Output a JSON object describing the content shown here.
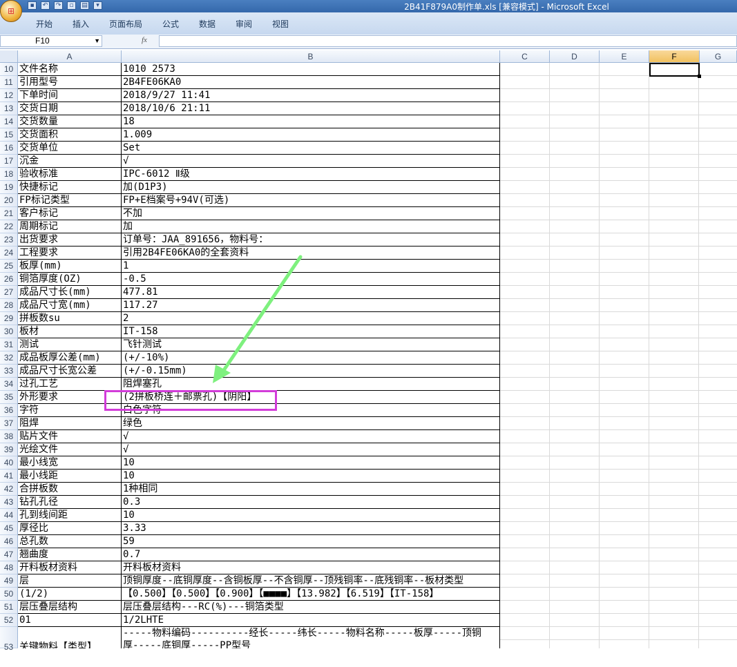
{
  "titlebar": {
    "title": "2B41F879A0制作单.xls  [兼容模式] - Microsoft Excel"
  },
  "ribbon": {
    "tabs": [
      "开始",
      "插入",
      "页面布局",
      "公式",
      "数据",
      "审阅",
      "视图"
    ]
  },
  "formula_bar": {
    "name_box": "F10",
    "fx_label": "fx",
    "formula": ""
  },
  "columns": [
    "A",
    "B",
    "C",
    "D",
    "E",
    "F",
    "G"
  ],
  "selected_cell": "F10",
  "rows": [
    {
      "num": "10",
      "a": "文件名称",
      "b": "1010 2573"
    },
    {
      "num": "11",
      "a": "引用型号",
      "b": "2B4FE06KA0"
    },
    {
      "num": "12",
      "a": "下单时间",
      "b": "2018/9/27 11:41"
    },
    {
      "num": "13",
      "a": "交货日期",
      "b": "2018/10/6 21:11"
    },
    {
      "num": "14",
      "a": "交货数量",
      "b": "18"
    },
    {
      "num": "15",
      "a": "交货面积",
      "b": "1.009"
    },
    {
      "num": "16",
      "a": "交货单位",
      "b": "Set"
    },
    {
      "num": "17",
      "a": "沉金",
      "b": "√"
    },
    {
      "num": "18",
      "a": "验收标准",
      "b": "IPC-6012 Ⅱ级"
    },
    {
      "num": "19",
      "a": "快捷标记",
      "b": "加(D1P3)"
    },
    {
      "num": "20",
      "a": "FP标记类型",
      "b": "FP+E档案号+94V(可选)"
    },
    {
      "num": "21",
      "a": "客户标记",
      "b": "不加"
    },
    {
      "num": "22",
      "a": "周期标记",
      "b": "加"
    },
    {
      "num": "23",
      "a": "出货要求",
      "b": "订单号：JAA_891656，物料号："
    },
    {
      "num": "24",
      "a": "工程要求",
      "b": "引用2B4FE06KA0的全套资料"
    },
    {
      "num": "25",
      "a": "板厚(mm)",
      "b": "1"
    },
    {
      "num": "26",
      "a": "铜箔厚度(OZ)",
      "b": "-0.5"
    },
    {
      "num": "27",
      "a": "成品尺寸长(mm)",
      "b": "477.81"
    },
    {
      "num": "28",
      "a": "成品尺寸宽(mm)",
      "b": "117.27"
    },
    {
      "num": "29",
      "a": "拼板数su",
      "b": "2"
    },
    {
      "num": "30",
      "a": "板材",
      "b": "IT-158"
    },
    {
      "num": "31",
      "a": "测试",
      "b": "飞针测试"
    },
    {
      "num": "32",
      "a": "成品板厚公差(mm)",
      "b": "(+/-10%)"
    },
    {
      "num": "33",
      "a": "成品尺寸长宽公差",
      "b": "(+/-0.15mm)"
    },
    {
      "num": "34",
      "a": "过孔工艺",
      "b": "阻焊塞孔"
    },
    {
      "num": "35",
      "a": "外形要求",
      "b": "(2拼板桥连＋邮票孔)【阴阳】"
    },
    {
      "num": "36",
      "a": "字符",
      "b": "白色字符"
    },
    {
      "num": "37",
      "a": "阻焊",
      "b": "绿色"
    },
    {
      "num": "38",
      "a": "贴片文件",
      "b": "√"
    },
    {
      "num": "39",
      "a": "光绘文件",
      "b": "√"
    },
    {
      "num": "40",
      "a": "最小线宽",
      "b": "10"
    },
    {
      "num": "41",
      "a": "最小线距",
      "b": "10"
    },
    {
      "num": "42",
      "a": "合拼板数",
      "b": "1种相同"
    },
    {
      "num": "43",
      "a": "钻孔孔径",
      "b": "0.3"
    },
    {
      "num": "44",
      "a": "孔到线间距",
      "b": "10"
    },
    {
      "num": "45",
      "a": "厚径比",
      "b": "3.33"
    },
    {
      "num": "46",
      "a": "总孔数",
      "b": "59"
    },
    {
      "num": "47",
      "a": "翘曲度",
      "b": "0.7"
    },
    {
      "num": "48",
      "a": "开料板材资料",
      "b": "开料板材资料"
    },
    {
      "num": "49",
      "a": "层",
      "b": "顶铜厚度--底铜厚度--含铜板厚--不含铜厚--顶残铜率--底残铜率--板材类型"
    },
    {
      "num": "50",
      "a": "(1/2)",
      "b": "【0.500】【0.500】【0.900】【■■■■】【13.982】【6.519】【IT-158】"
    },
    {
      "num": "51",
      "a": "层压叠层结构",
      "b": "层压叠层结构---RC(%)---铜箔类型"
    },
    {
      "num": "52",
      "a": "01",
      "b": "1/2LHTE"
    },
    {
      "num": "53",
      "a": "关键物料【类型】",
      "b": "-----物料编码----------经长-----纬长-----物料名称-----板厚-----顶铜"
    }
  ],
  "row53_b_line2": "厚-----底铜厚-----PP型号",
  "colors": {
    "highlight": "#d23cd9",
    "arrow": "#7ef07e",
    "selected_header": "#f1c15f"
  }
}
